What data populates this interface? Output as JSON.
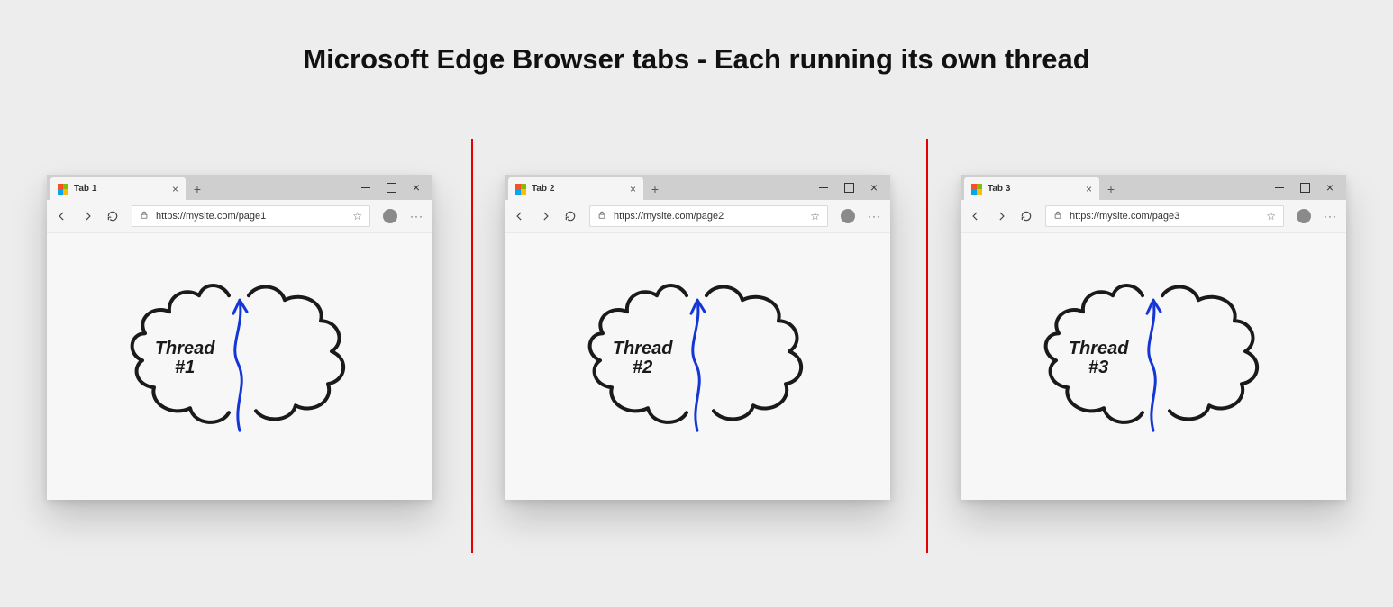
{
  "title": "Microsoft Edge Browser tabs - Each running its own thread",
  "colors": {
    "divider": "#e60000",
    "cloudStroke": "#1a1a1a",
    "arrow": "#1436d6"
  },
  "browsers": [
    {
      "tab": "Tab 1",
      "url": "https://mysite.com/page1",
      "thread_line1": "Thread",
      "thread_line2": "#1"
    },
    {
      "tab": "Tab 2",
      "url": "https://mysite.com/page2",
      "thread_line1": "Thread",
      "thread_line2": "#2"
    },
    {
      "tab": "Tab 3",
      "url": "https://mysite.com/page3",
      "thread_line1": "Thread",
      "thread_line2": "#3"
    }
  ]
}
